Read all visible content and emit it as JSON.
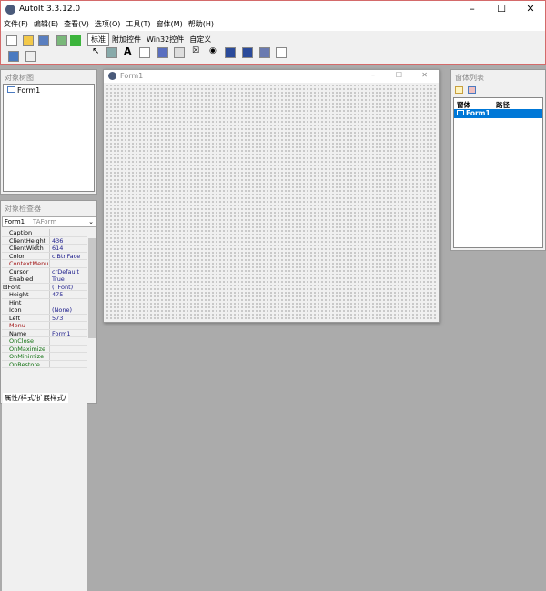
{
  "app": {
    "title": "AutoIt 3.3.12.0"
  },
  "menu": [
    "文件(F)",
    "编辑(E)",
    "查看(V)",
    "选项(O)",
    "工具(T)",
    "窗体(M)",
    "帮助(H)"
  ],
  "palette_tabs": [
    "标准",
    "附加控件",
    "Win32控件",
    "自定义"
  ],
  "tree": {
    "title": "对象树图",
    "items": [
      "Form1"
    ]
  },
  "inspector": {
    "title": "对象检查器",
    "object": "Form1",
    "class": "TAForm",
    "props": [
      [
        "Caption",
        ""
      ],
      [
        "ClientHeight",
        "436"
      ],
      [
        "ClientWidth",
        "614"
      ],
      [
        "Color",
        "clBtnFace"
      ],
      [
        "ContextMenu",
        ""
      ],
      [
        "Cursor",
        "crDefault"
      ],
      [
        "Enabled",
        "True"
      ],
      [
        "Font",
        "(TFont)"
      ],
      [
        "Height",
        "475"
      ],
      [
        "Hint",
        ""
      ],
      [
        "Icon",
        "(None)"
      ],
      [
        "Left",
        "573"
      ],
      [
        "Menu",
        ""
      ],
      [
        "Name",
        "Form1"
      ],
      [
        "OnClose",
        ""
      ],
      [
        "OnMaximize",
        ""
      ],
      [
        "OnMinimize",
        ""
      ],
      [
        "OnRestore",
        ""
      ]
    ],
    "tabs": [
      "属性",
      "样式",
      "扩展样式"
    ]
  },
  "form": {
    "title": "Form1"
  },
  "formlist": {
    "title": "窗体列表",
    "col_window": "窗体",
    "col_path": "路径",
    "items": [
      "Form1"
    ]
  }
}
